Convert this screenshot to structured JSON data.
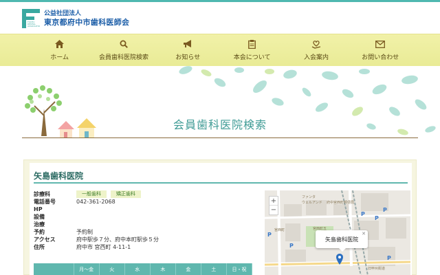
{
  "logo": {
    "line1": "公益社団法人",
    "line2": "東京都府中市歯科医師会",
    "mark_text": "FUCHU DENTAL ASSOCIATION"
  },
  "nav": [
    {
      "label": "ホーム",
      "icon": "home-icon"
    },
    {
      "label": "会員歯科医院検索",
      "icon": "search-icon"
    },
    {
      "label": "お知らせ",
      "icon": "megaphone-icon"
    },
    {
      "label": "本会について",
      "icon": "clipboard-icon"
    },
    {
      "label": "入会案内",
      "icon": "heart-hand-icon"
    },
    {
      "label": "お問い合わせ",
      "icon": "envelope-icon"
    }
  ],
  "hero": {
    "title": "会員歯科医院検索"
  },
  "clinic": {
    "name": "矢島歯科医院",
    "fields": {
      "specialty_label": "診療科",
      "specialty_tags": [
        "一般歯科",
        "矯正歯科"
      ],
      "phone_label": "電話番号",
      "phone": "042-361-2068",
      "hp_label": "HP",
      "hp": "",
      "equipment_label": "設備",
      "equipment": "",
      "treatment_label": "治療",
      "treatment": "",
      "reservation_label": "予約",
      "reservation": "予約制",
      "access_label": "アクセス",
      "access": "府中駅歩７分、府中本町駅歩５分",
      "address_label": "住所",
      "address": "府中市 宮西町 4-11-1"
    },
    "hours_header": [
      "",
      "月～金",
      "火",
      "水",
      "木",
      "金",
      "土",
      "日・祝"
    ]
  },
  "map": {
    "popup": "矢島歯科医院",
    "zoom_in": "+",
    "zoom_out": "−",
    "labels": {
      "fanta": "ファンタ",
      "fanta2": "ウェルアンド",
      "miyanishi": "宮西町",
      "ugo": "宮西町五",
      "road": "旧甲州街道",
      "pharmacy": "府中宮西町郵便局"
    }
  },
  "colors": {
    "accent": "#4fb8b0",
    "nav_bg": "#ecec9c",
    "brand_blue": "#1c5ea8"
  }
}
